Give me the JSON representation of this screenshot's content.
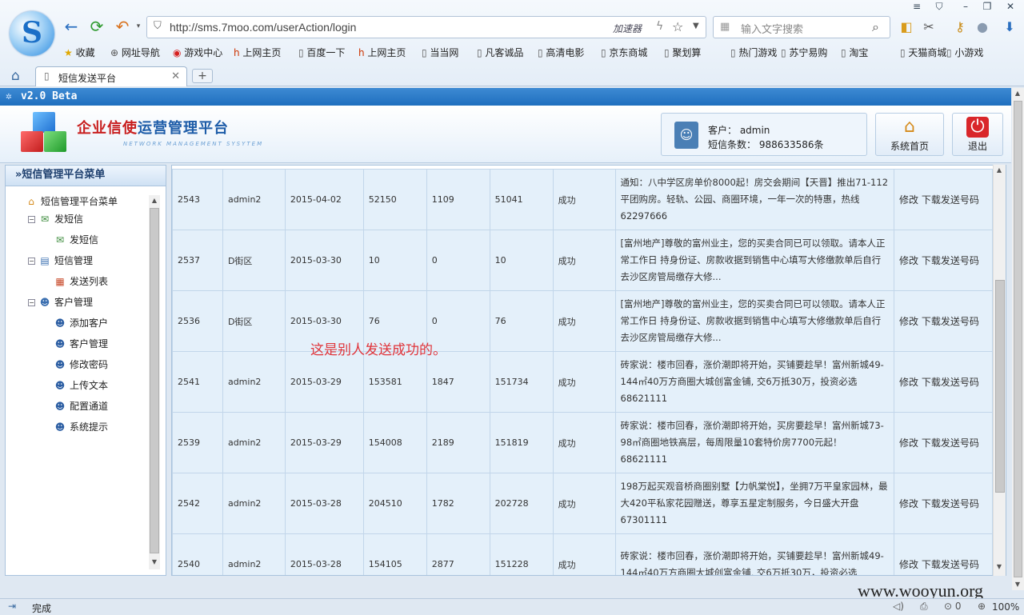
{
  "browser": {
    "url": "http://sms.7moo.com/userAction/login",
    "accelerator_label": "加速器",
    "search_placeholder": "输入文字搜索",
    "tab_title": "短信发送平台",
    "bookmarks": [
      "收藏",
      "网址导航",
      "游戏中心",
      "上网主页",
      "百度一下",
      "上网主页",
      "当当网",
      "凡客诚品",
      "高清电影",
      "京东商城",
      "聚划算",
      "热门游戏",
      "苏宁易购",
      "淘宝",
      "天猫商城",
      "小游戏"
    ],
    "status_text": "完成",
    "zoom": "100%",
    "watermark": "www.wooyun.org"
  },
  "app": {
    "version": "v2.0 Beta",
    "title_red": "企业信使",
    "title_blue": "运营管理平台",
    "subtitle": "NETWORK MANAGEMENT SYSYTEM",
    "user_label": "客户：  admin",
    "sms_count_label": "短信条数：  988633586条",
    "home_button": "系统首页",
    "logout_button": "退出"
  },
  "sidebar": {
    "header": "»短信管理平台菜单",
    "root": "短信管理平台菜单",
    "groups": [
      {
        "label": "发短信",
        "items": [
          "发短信"
        ]
      },
      {
        "label": "短信管理",
        "items": [
          "发送列表"
        ]
      },
      {
        "label": "客户管理",
        "items": [
          "添加客户",
          "客户管理",
          "修改密码",
          "上传文本",
          "配置通道",
          "系统提示"
        ]
      }
    ]
  },
  "table": {
    "rows": [
      {
        "id": "2543",
        "user": "admin2",
        "date": "2015-04-02",
        "total": "52150",
        "fail": "1109",
        "ok": "51041",
        "status": "成功",
        "msg": "通知：八中学区房单价8000起！房交会期间【天晋】推出71-112平团购房。轻轨、公园、商圈环境，一年一次的特惠，热线62297666",
        "edit": "修改",
        "download": "下载发送号码"
      },
      {
        "id": "2537",
        "user": "D街区",
        "date": "2015-03-30",
        "total": "10",
        "fail": "0",
        "ok": "10",
        "status": "成功",
        "msg": "[富州地产]尊敬的富州业主，您的买卖合同已可以领取。请本人正常工作日 持身份证、房款收据到销售中心填写大修缴款单后自行去沙区房管局缴存大修...",
        "edit": "修改",
        "download": "下载发送号码"
      },
      {
        "id": "2536",
        "user": "D街区",
        "date": "2015-03-30",
        "total": "76",
        "fail": "0",
        "ok": "76",
        "status": "成功",
        "msg": "[富州地产]尊敬的富州业主，您的买卖合同已可以领取。请本人正常工作日 持身份证、房款收据到销售中心填写大修缴款单后自行去沙区房管局缴存大修...",
        "edit": "修改",
        "download": "下载发送号码"
      },
      {
        "id": "2541",
        "user": "admin2",
        "date": "2015-03-29",
        "total": "153581",
        "fail": "1847",
        "ok": "151734",
        "status": "成功",
        "msg": "砖家说：楼市回春，涨价潮即将开始，买铺要趁早！富州新城49-144㎡40万方商圈大城创富金铺, 交6万抵30万，投资必选68621111",
        "edit": "修改",
        "download": "下载发送号码"
      },
      {
        "id": "2539",
        "user": "admin2",
        "date": "2015-03-29",
        "total": "154008",
        "fail": "2189",
        "ok": "151819",
        "status": "成功",
        "msg": "砖家说：楼市回春，涨价潮即将开始，买房要趁早！富州新城73-98㎡商圈地铁高层，每周限量10套特价房7700元起！68621111",
        "edit": "修改",
        "download": "下载发送号码"
      },
      {
        "id": "2542",
        "user": "admin2",
        "date": "2015-03-28",
        "total": "204510",
        "fail": "1782",
        "ok": "202728",
        "status": "成功",
        "msg": "198万起买观音桥商圈别墅【力帆棠悦】，坐拥7万平皇家园林，最大420平私家花园赠送，尊享五星定制服务，今日盛大开盘67301111",
        "edit": "修改",
        "download": "下载发送号码"
      },
      {
        "id": "2540",
        "user": "admin2",
        "date": "2015-03-28",
        "total": "154105",
        "fail": "2877",
        "ok": "151228",
        "status": "成功",
        "msg": "砖家说：楼市回春，涨价潮即将开始，买铺要趁早！富州新城49-144㎡40万方商圈大城创富金铺, 交6万抵30万，投资必选",
        "edit": "修改",
        "download": "下载发送号码"
      }
    ]
  },
  "annotation": "这是别人发送成功的。",
  "colors": {
    "accent": "#1f6fbf",
    "title_red": "#c81e1e",
    "title_blue": "#1d5ca8",
    "annotation": "#e0343a",
    "row_bg": "#e4f0fa"
  }
}
